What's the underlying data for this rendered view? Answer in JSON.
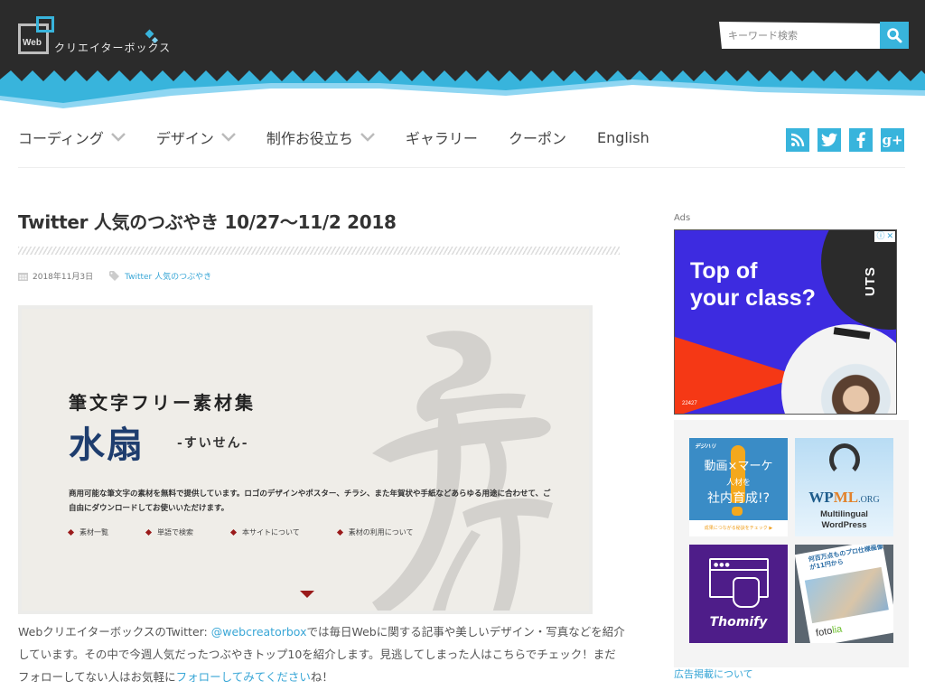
{
  "header": {
    "logo_web": "Web",
    "logo_text": "クリエイターボックス",
    "search_placeholder": "キーワード検索",
    "search_icon": "magnifier-icon",
    "colors": {
      "header_bg": "#2b2b2b",
      "accent": "#38b4dc"
    }
  },
  "nav": {
    "items": [
      {
        "label": "コーディング",
        "has_dropdown": true
      },
      {
        "label": "デザイン",
        "has_dropdown": true
      },
      {
        "label": "制作お役立ち",
        "has_dropdown": true
      },
      {
        "label": "ギャラリー",
        "has_dropdown": false
      },
      {
        "label": "クーポン",
        "has_dropdown": false
      },
      {
        "label": "English",
        "has_dropdown": false
      }
    ],
    "social": [
      {
        "name": "rss",
        "icon": "rss-icon"
      },
      {
        "name": "twitter",
        "icon": "twitter-icon"
      },
      {
        "name": "facebook",
        "icon": "facebook-icon"
      },
      {
        "name": "google-plus",
        "icon": "google-plus-icon"
      }
    ]
  },
  "article": {
    "title": "Twitter 人気のつぶやき 10/27〜11/2 2018",
    "date": "2018年11月3日",
    "category": "Twitter 人気のつぶやき",
    "hero": {
      "subtitle": "筆文字フリー素材集",
      "main": "水扇",
      "reading": "-すいせん-",
      "description": "商用可能な筆文字の素材を無料で提供しています。ロゴのデザインやポスター、チラシ、また年賀状や手紙などあらゆる用途に合わせて、ご自由にダウンロードしてお使いいただけます。",
      "links": [
        "素材一覧",
        "単語で検索",
        "本サイトについて",
        "素材の利用について"
      ]
    },
    "body": {
      "p1_pre": "WebクリエイターボックスのTwitter: ",
      "p1_link": "@webcreatorbox",
      "p1_mid": "では毎日Webに関する記事や美しいデザイン・写真などを紹介しています。その中で今週人気だったつぶやきトップ10を紹介します。見逃してしまった人はこちらでチェック！まだフォローしてない人はお気軽に",
      "p1_link2": "フォローしてみてください",
      "p1_post": "ね！"
    }
  },
  "sidebar": {
    "ads_label": "Ads",
    "main_ad": {
      "headline_line1": "Top of",
      "headline_line2": "your class?",
      "brand": "UTS",
      "code": "22427",
      "info_icon": "ⓘ",
      "close_icon": "✕"
    },
    "tiles": {
      "tile1": {
        "brand": "デジハリ",
        "line1": "動画×マーケ",
        "line2": "人材を",
        "line3": "社内育成!?",
        "footer": "成果につながる秘訣をチェック ▶"
      },
      "tile2": {
        "logo_wp": "WP",
        "logo_ml": "ML",
        "logo_org": ".ORG",
        "line1": "Multilingual",
        "line2": "WordPress"
      },
      "tile3": {
        "name": "Thomify"
      },
      "tile4": {
        "headline": "何百万点ものプロ仕様画像が11円から",
        "brand_pre": "foto",
        "brand_post": "lia"
      }
    },
    "ad_about": "広告掲載について"
  }
}
